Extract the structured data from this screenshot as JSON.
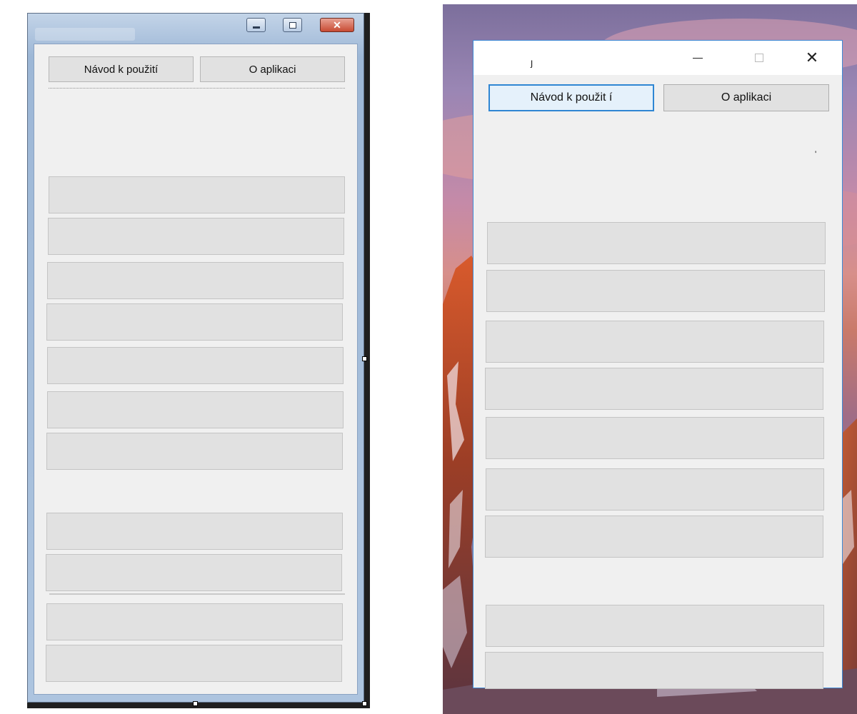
{
  "designer_window": {
    "title": "",
    "buttons": {
      "manual_label": "Návod k použití",
      "about_label": "O aplikaci"
    },
    "caption_icons": [
      "minimize-icon",
      "maximize-icon",
      "close-icon"
    ],
    "close_glyph": "✕"
  },
  "runtime_window": {
    "title": "ȷ",
    "buttons": {
      "manual_label": "Návod k použit í",
      "about_label": "O aplikaci"
    },
    "stray_char": "'",
    "caption_icons": [
      "minimize-icon",
      "maximize-icon",
      "close-icon"
    ],
    "close_glyph": "✕"
  },
  "colors": {
    "button_face": "#e1e1e1",
    "window_bg": "#f0f0f0",
    "focus_border": "#2f86d3",
    "w7_close": "#c84b33"
  }
}
